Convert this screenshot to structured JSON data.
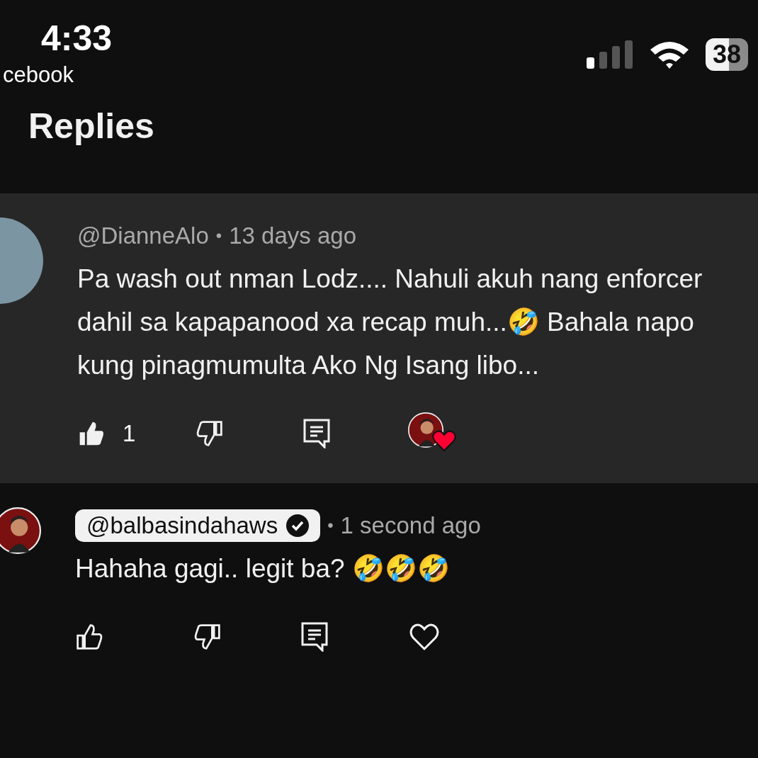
{
  "status_bar": {
    "time": "4:33",
    "back_app": "cebook",
    "battery": "38"
  },
  "header": {
    "title": "Replies"
  },
  "comments": [
    {
      "highlighted": true,
      "author": "@DianneAlo",
      "author_is_creator": false,
      "separator": "•",
      "time": "13 days ago",
      "text": "Pa wash out nman Lodz.... Nahuli akuh nang enforcer dahil sa kapapanood xa recap muh...🤣 Bahala napo kung pinagmumulta Ako Ng Isang libo...",
      "liked": true,
      "like_count": "1",
      "creator_hearted": true
    },
    {
      "highlighted": false,
      "author": "@balbasindahaws",
      "author_is_creator": true,
      "separator": "•",
      "time": "1 second ago",
      "text": "Hahaha gagi.. legit ba? 🤣🤣🤣",
      "liked": false,
      "creator_hearted": false
    }
  ]
}
